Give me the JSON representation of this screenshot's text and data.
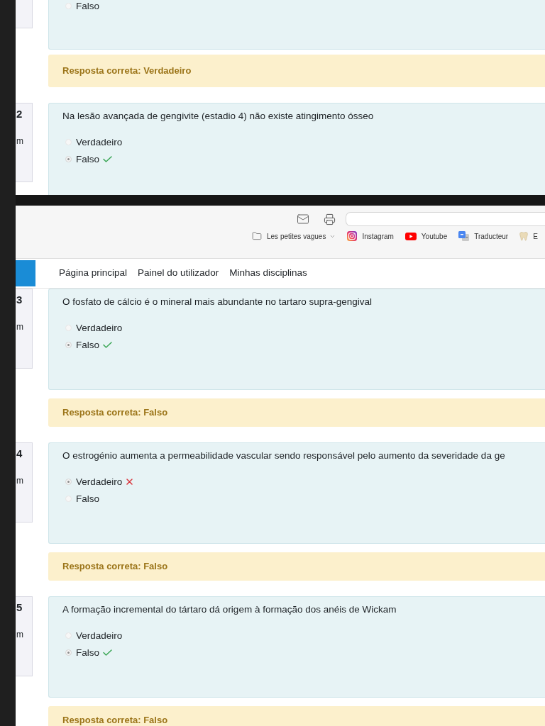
{
  "upper": {
    "partial_question": {
      "options": [
        {
          "label": "Falso",
          "selected": false
        }
      ]
    },
    "feedback": "Resposta correta: Verdadeiro",
    "question": {
      "number": "2",
      "info_text": "m",
      "prompt": "Na lesão avançada de gengivite (estadio 4) não existe atingimento ósseo",
      "options": [
        {
          "label": "Verdadeiro",
          "selected": false
        },
        {
          "label": "Falso",
          "selected": true,
          "kind": "correct"
        }
      ]
    }
  },
  "browser": {
    "bookmarks": [
      {
        "kind": "folder",
        "label": "Les petites vagues"
      },
      {
        "kind": "instagram",
        "label": "Instagram"
      },
      {
        "kind": "youtube",
        "label": "Youtube"
      },
      {
        "kind": "translate",
        "label": "Traducteur"
      },
      {
        "kind": "tooth",
        "label": "E"
      }
    ]
  },
  "nav": {
    "items": [
      "Página principal",
      "Painel do utilizador",
      "Minhas disciplinas"
    ]
  },
  "questions": [
    {
      "number": "3",
      "info_text": "m",
      "prompt": "O fosfato de cálcio é o mineral mais abundante no tartaro supra-gengival",
      "options": [
        {
          "label": "Verdadeiro",
          "selected": false
        },
        {
          "label": "Falso",
          "selected": true,
          "kind": "correct"
        }
      ],
      "feedback": "Resposta correta: Falso"
    },
    {
      "number": "4",
      "info_text": "m",
      "prompt": "O estrogénio aumenta a permeabilidade vascular sendo responsável pelo aumento da severidade da ge",
      "options": [
        {
          "label": "Verdadeiro",
          "selected": true,
          "kind": "incorrect"
        },
        {
          "label": "Falso",
          "selected": false
        }
      ],
      "feedback": "Resposta correta: Falso"
    },
    {
      "number": "5",
      "info_text": "m",
      "prompt": "A formação incremental do tártaro dá origem à formação dos anéis de Wickam",
      "options": [
        {
          "label": "Verdadeiro",
          "selected": false
        },
        {
          "label": "Falso",
          "selected": true,
          "kind": "correct"
        }
      ],
      "feedback": "Resposta correta: Falso"
    }
  ]
}
